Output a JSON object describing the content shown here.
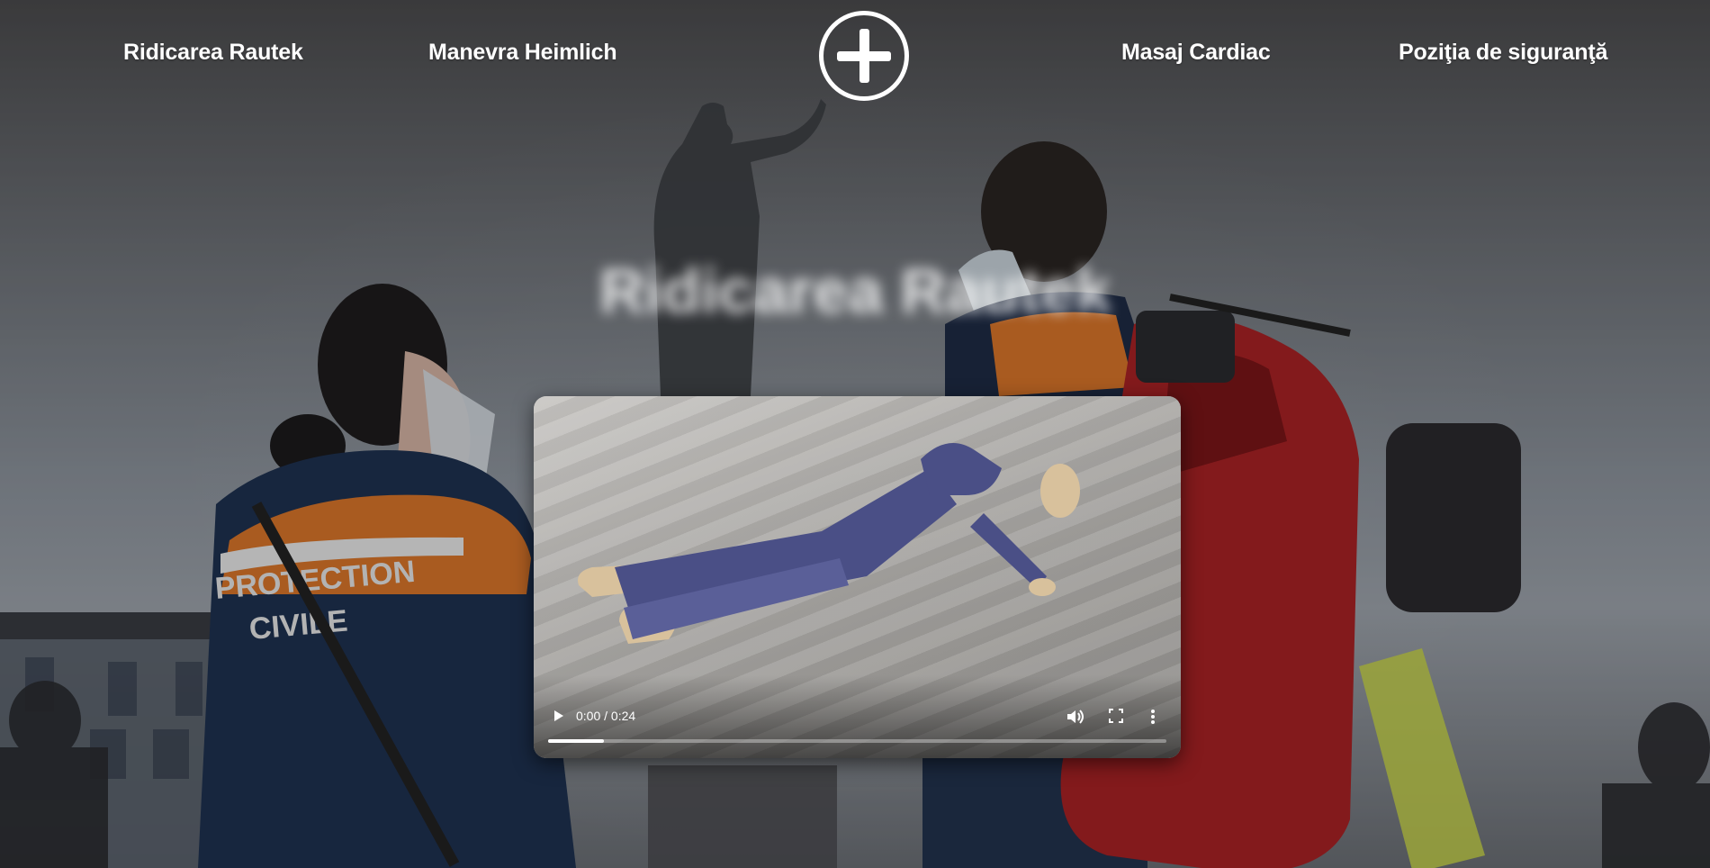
{
  "nav": {
    "items": [
      {
        "label": "Ridicarea Rautek"
      },
      {
        "label": "Manevra Heimlich"
      },
      {
        "label": "Masaj Cardiac"
      },
      {
        "label": "Poziţia de siguranţă"
      }
    ],
    "logo_icon": "plus-circle-icon"
  },
  "hero": {
    "title": "Ridicarea Rautek"
  },
  "video": {
    "time_display": "0:00 / 0:24",
    "progress_buffered": 0.09,
    "icons": [
      "play-icon",
      "volume-icon",
      "fullscreen-icon",
      "more-vert-icon"
    ]
  },
  "colors": {
    "text": "#ffffff",
    "orange": "#e0782a",
    "navy": "#1d2b44",
    "red_bag": "#b3262a"
  }
}
